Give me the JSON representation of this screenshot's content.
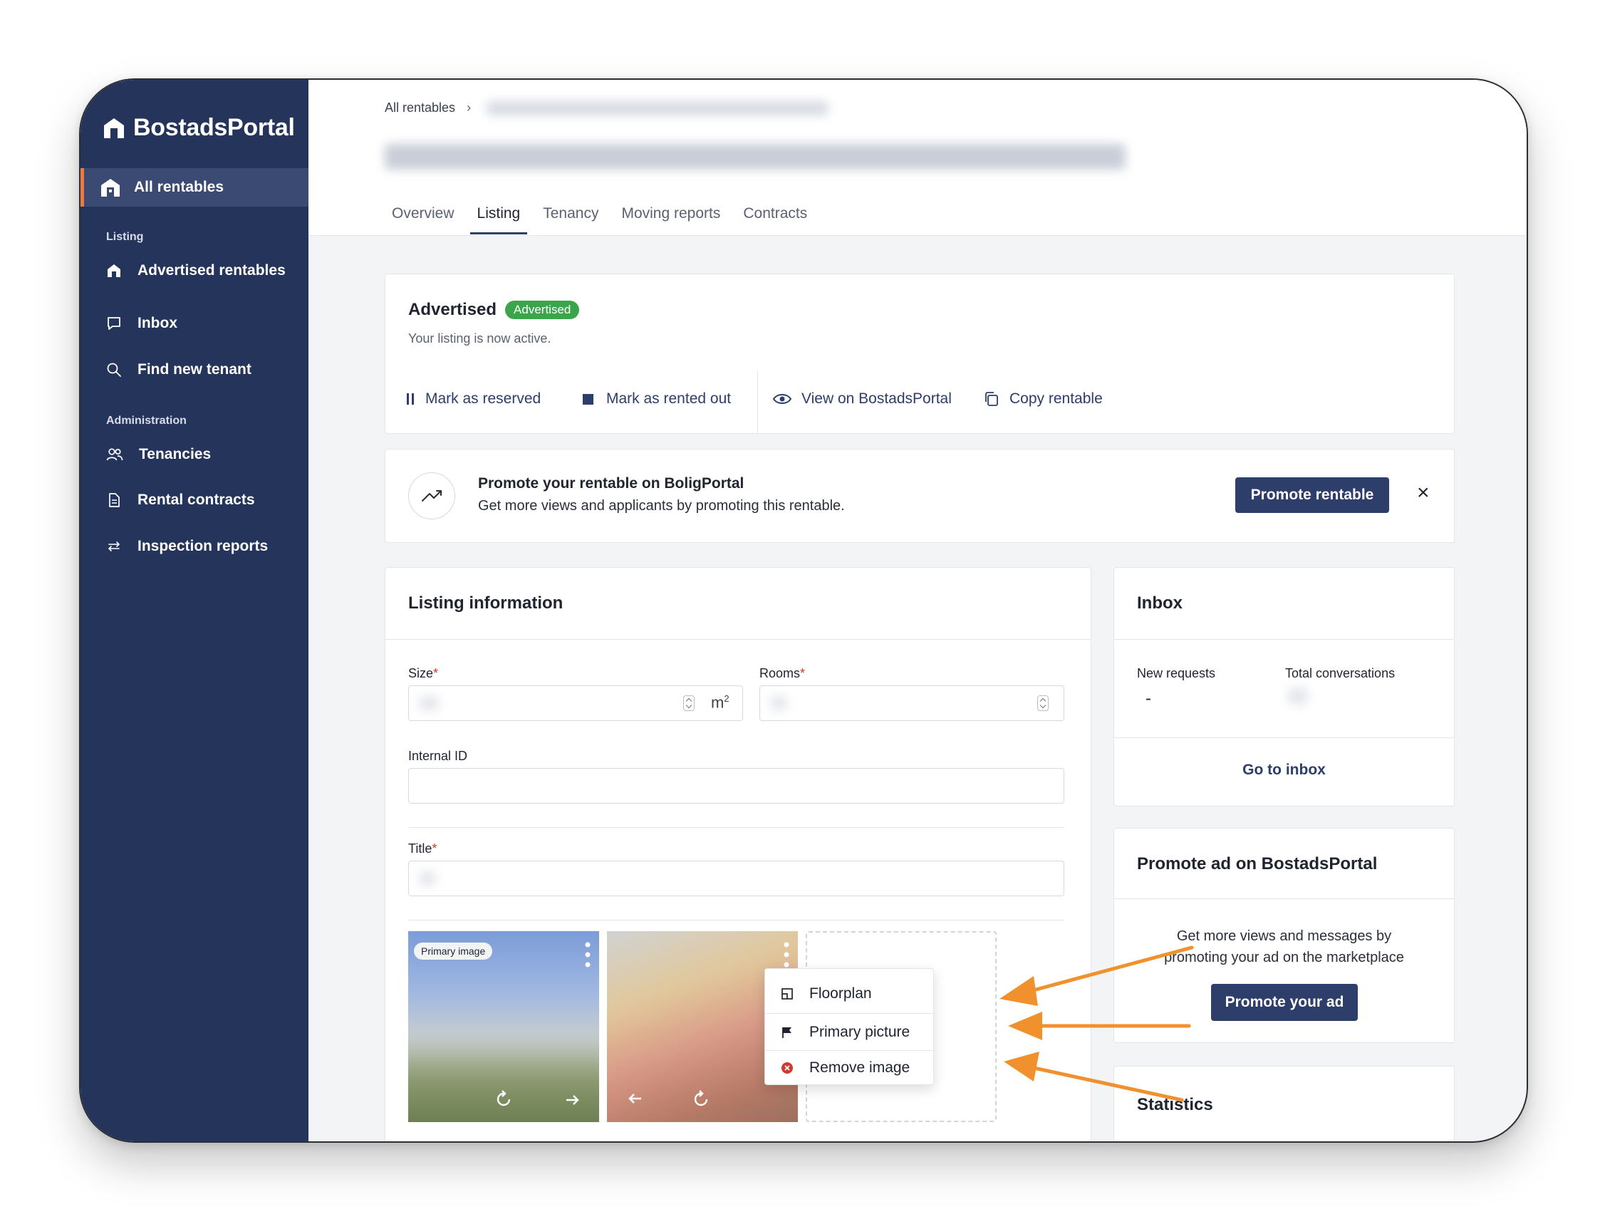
{
  "app": {
    "name": "BostadsPortal"
  },
  "sidebar": {
    "active_item": "All rentables",
    "sections": [
      {
        "title": "Listing",
        "items": [
          "Advertised rentables",
          "Inbox",
          "Find new tenant"
        ]
      },
      {
        "title": "Administration",
        "items": [
          "Tenancies",
          "Rental contracts",
          "Inspection reports"
        ]
      }
    ]
  },
  "header": {
    "breadcrumb_root": "All rentables",
    "tabs": [
      "Overview",
      "Listing",
      "Tenancy",
      "Moving reports",
      "Contracts"
    ],
    "active_tab": "Listing"
  },
  "status_card": {
    "title": "Advertised",
    "badge": "Advertised",
    "subtitle": "Your listing is now active.",
    "actions": [
      "Mark as reserved",
      "Mark as rented out",
      "View on BostadsPortal",
      "Copy rentable"
    ]
  },
  "promo_banner": {
    "title": "Promote your rentable on BoligPortal",
    "text": "Get more views and applicants by promoting this rentable.",
    "button": "Promote rentable",
    "close": "×"
  },
  "listing_info": {
    "title": "Listing information",
    "size_label": "Size",
    "size_unit": "m",
    "size_unit_sup": "2",
    "rooms_label": "Rooms",
    "internal_id_label": "Internal ID",
    "title_label": "Title",
    "required_mark": "*",
    "primary_image_badge": "Primary image",
    "context_menu": [
      "Floorplan",
      "Primary picture",
      "Remove image"
    ]
  },
  "inbox_card": {
    "title": "Inbox",
    "new_requests_label": "New requests",
    "new_requests_value": "-",
    "total_conversations_label": "Total conversations",
    "link": "Go to inbox"
  },
  "promote_ad_card": {
    "title": "Promote ad on BostadsPortal",
    "text_line1": "Get more views and messages by",
    "text_line2": "promoting your ad on the marketplace",
    "button": "Promote your ad"
  },
  "statistics_card": {
    "title": "Statistics"
  },
  "colors": {
    "sidebar": "#25345a",
    "accent": "#ec7b40",
    "navy": "#2d3e6a",
    "badge_green": "#3aa54a",
    "arrow_orange": "#f0912e",
    "danger": "#d03a2c"
  }
}
